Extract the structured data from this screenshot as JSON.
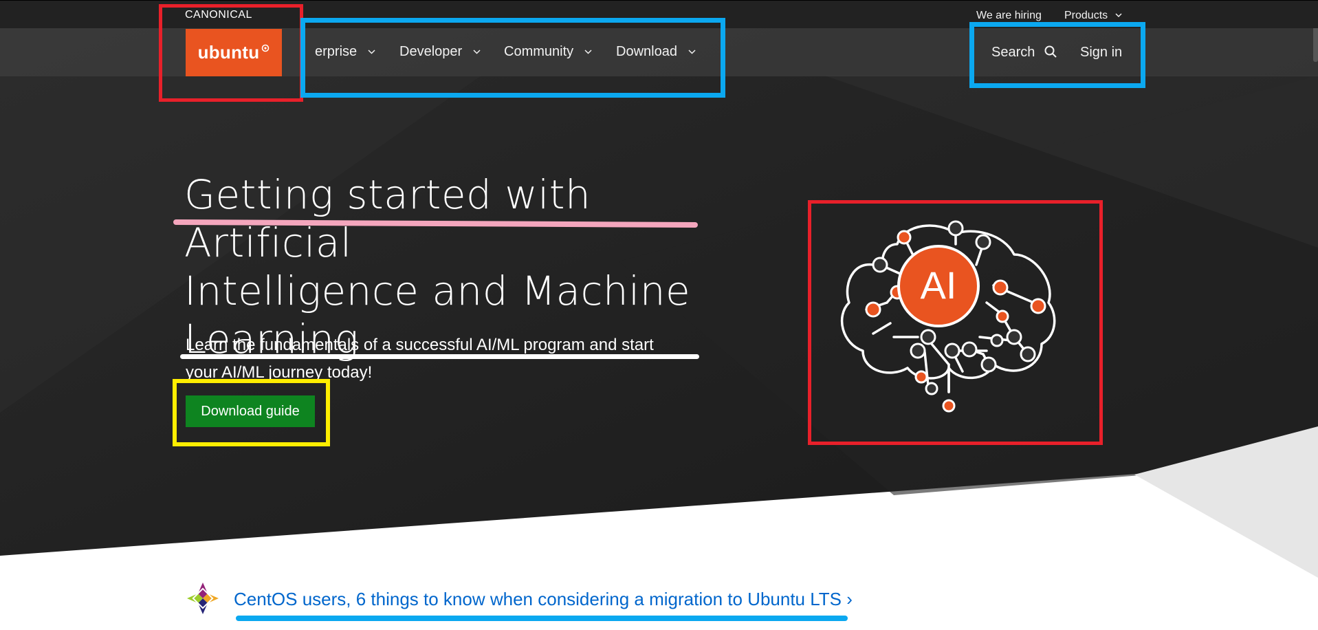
{
  "top_bar": {
    "canonical_logo": "CANONICAL",
    "hiring_link": "We are hiring",
    "products_label": "Products"
  },
  "nav": {
    "logo_text": "ubuntu",
    "items": [
      {
        "label": "erprise"
      },
      {
        "label": "Developer"
      },
      {
        "label": "Community"
      },
      {
        "label": "Download"
      }
    ],
    "search_label": "Search",
    "signin_label": "Sign in"
  },
  "hero": {
    "title_lines": [
      "Getting started with Artificial",
      "Intelligence and Machine",
      "Learning"
    ],
    "subtitle_lines": [
      "Learn the fundamentals of a successful AI/ML program and start",
      "your AI/ML journey today!"
    ],
    "cta_label": "Download guide",
    "illustration_text": "AI"
  },
  "banner": {
    "link_text": "CentOS users, 6 things to know when considering a migration to Ubuntu LTS ›"
  },
  "colors": {
    "ubuntu_orange": "#e95420",
    "cta_green": "#0e8420",
    "link_blue": "#0066cc",
    "annotation_red": "#e8202a",
    "annotation_blue": "#0ba8f0",
    "annotation_yellow": "#ffee00"
  },
  "icons": [
    "chevron-down-icon",
    "search-icon",
    "ubuntu-circle-icon",
    "centos-icon",
    "ai-brain-icon"
  ]
}
